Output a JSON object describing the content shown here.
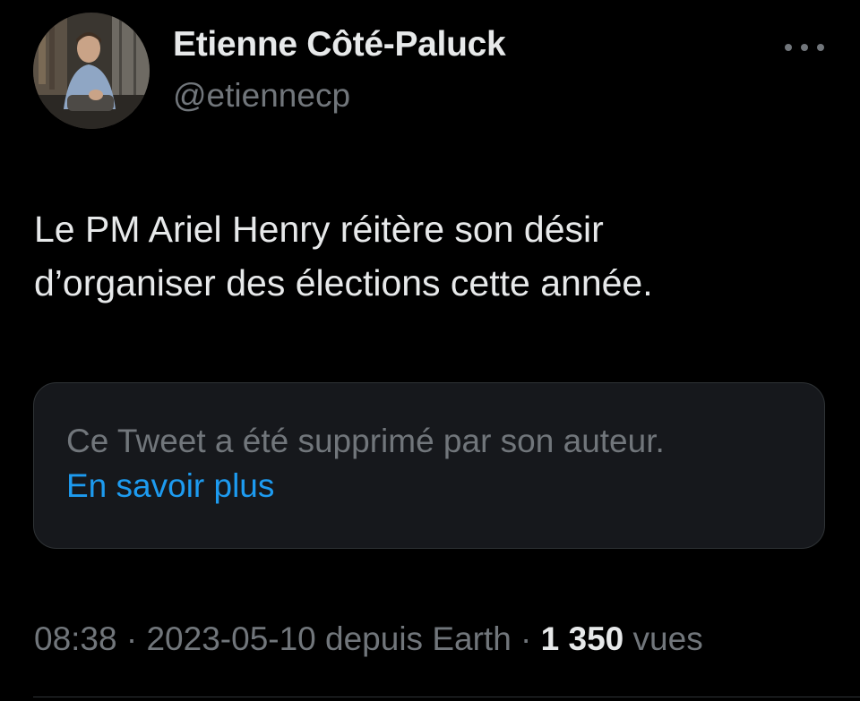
{
  "author": {
    "display_name": "Etienne Côté-Paluck",
    "handle": "@etiennecp",
    "avatar_icon": "profile-photo"
  },
  "more_icon": "ellipsis-horizontal-icon",
  "tweet": {
    "text": "Le PM Ariel Henry réitère son désir\nd’organiser des élections cette année."
  },
  "quote": {
    "deleted_text": "Ce Tweet a été supprimé par son auteur.",
    "learn_more": "En savoir plus"
  },
  "meta": {
    "time": "08:38",
    "separator": " · ",
    "date": "2023-05-10",
    "source": "depuis Earth",
    "views_count": "1 350",
    "views_label": "vues"
  },
  "colors": {
    "background": "#000000",
    "primary_text": "#e7e9ea",
    "secondary_text": "#71767b",
    "link": "#1d9bf0",
    "card_background": "#16181c",
    "border": "#2f3336"
  }
}
